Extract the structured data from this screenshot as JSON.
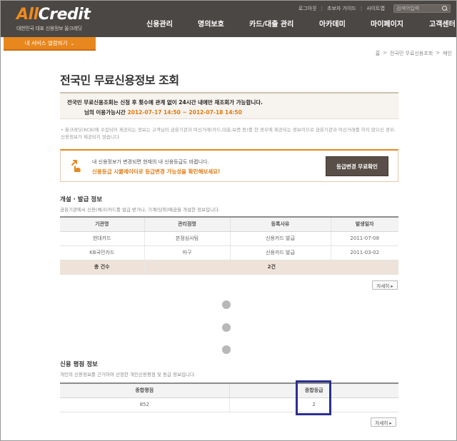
{
  "brand": {
    "logo_part1": "All",
    "logo_part2": "Credit",
    "tagline": "대한민국 대표 신용정보 올크레딧",
    "accent": "#e8871e"
  },
  "util_nav": {
    "items": [
      "로그아웃",
      "초보자 가이드",
      "사이트맵"
    ],
    "search_placeholder": "검색어입력"
  },
  "gnb": {
    "items": [
      "신용관리",
      "명의보호",
      "카드/대출 관리",
      "아카데미",
      "마이페이지",
      "고객센터"
    ]
  },
  "service_dropdown": {
    "label": "내 서비스 열람하기",
    "chevron": "⌄"
  },
  "breadcrumb": [
    "홈",
    ">",
    "전국민 무료신용조회",
    ">",
    "메인"
  ],
  "page_title": "전국민 무료신용정보 조회",
  "notice": {
    "line1": "전국민 무료신용조회는 신청 후 횟수에 관계 없이 24시간 내에만 재조회가 가능합니다.",
    "line2_prefix": "님의 이용가능시간",
    "line2_period": "2012-07-17 14:50 ~ 2012-07-18 14:50"
  },
  "footnote": "• 올크레딧(KCB)에 수집되어 제공되는 정보는 고객님이 금융기관과 여신거래(카드,대출,보증 등)를 한 경우에 제공되는 정보이므로 금융기관과 여신거래를 하지 않으신 경우, 신용정보가 제공되지 않습니다.",
  "upgrade": {
    "line1": "내 신용정보가 변경되면 현재의 내 신용등급도 바뀝니다.",
    "line2": "신용등급 시뮬레이터로 등급변경 가능성을 확인해보세요!",
    "button": "등급변경 무료확인"
  },
  "issuance": {
    "title": "개설 · 발급 정보",
    "desc": "금융기관에서 신용(체크)카드를 발급 받거나, 기계(당좌)예금을 개설한 정보입니다.",
    "headers": [
      "기관명",
      "관리점명",
      "등록사유",
      "발생일자"
    ],
    "rows": [
      [
        "현대카드",
        "본점심사팀",
        "신용카드 발급",
        "2011-07-08"
      ],
      [
        "KB국민카드",
        "마구",
        "신용카드 발급",
        "2011-03-02"
      ]
    ],
    "total_label": "총 건수",
    "total_value": "2건",
    "more_label": "자세히 ▸"
  },
  "rating": {
    "title": "신용 평점 정보",
    "desc": "개인의 신용정보를 근거하여 산정한 개인신용평점 및 등급 정보입니다.",
    "headers": [
      "종합평점",
      "종합등급"
    ],
    "values": [
      "852",
      "2"
    ],
    "more_label": "자세히 ▸"
  }
}
